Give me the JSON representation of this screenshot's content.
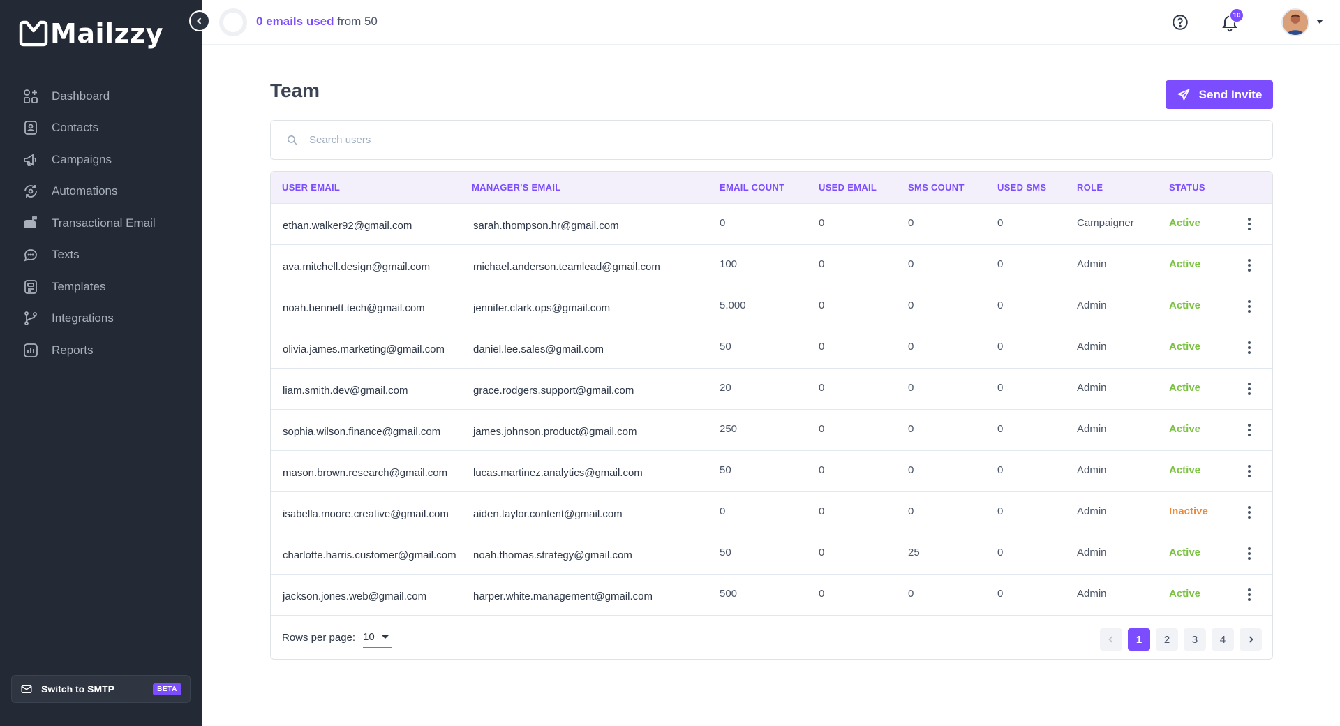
{
  "app": {
    "name": "Mailzzy"
  },
  "sidebar": {
    "items": [
      {
        "label": "Dashboard",
        "icon": "dashboard-icon"
      },
      {
        "label": "Contacts",
        "icon": "contacts-icon"
      },
      {
        "label": "Campaigns",
        "icon": "megaphone-icon"
      },
      {
        "label": "Automations",
        "icon": "automation-icon"
      },
      {
        "label": "Transactional Email",
        "icon": "mailbox-icon"
      },
      {
        "label": "Texts",
        "icon": "chat-icon"
      },
      {
        "label": "Templates",
        "icon": "template-icon"
      },
      {
        "label": "Integrations",
        "icon": "branch-icon"
      },
      {
        "label": "Reports",
        "icon": "chart-icon"
      }
    ],
    "smtp": {
      "label": "Switch to SMTP",
      "badge": "BETA"
    }
  },
  "header": {
    "usage": {
      "used": "0 emails used",
      "rest": "from 50"
    },
    "notifications": "10"
  },
  "page": {
    "title": "Team",
    "invite_label": "Send Invite",
    "search_placeholder": "Search users"
  },
  "table": {
    "columns": [
      "USER EMAIL",
      "MANAGER'S EMAIL",
      "EMAIL COUNT",
      "USED EMAIL",
      "SMS COUNT",
      "USED SMS",
      "ROLE",
      "STATUS"
    ],
    "rows": [
      {
        "user": "ethan.walker92@gmail.com",
        "manager": "sarah.thompson.hr@gmail.com",
        "email_count": "0",
        "used_email": "0",
        "sms_count": "0",
        "used_sms": "0",
        "role": "Campaigner",
        "status": "Active"
      },
      {
        "user": "ava.mitchell.design@gmail.com",
        "manager": "michael.anderson.teamlead@gmail.com",
        "email_count": "100",
        "used_email": "0",
        "sms_count": "0",
        "used_sms": "0",
        "role": "Admin",
        "status": "Active"
      },
      {
        "user": "noah.bennett.tech@gmail.com",
        "manager": "jennifer.clark.ops@gmail.com",
        "email_count": "5,000",
        "used_email": "0",
        "sms_count": "0",
        "used_sms": "0",
        "role": "Admin",
        "status": "Active"
      },
      {
        "user": "olivia.james.marketing@gmail.com",
        "manager": "daniel.lee.sales@gmail.com",
        "email_count": "50",
        "used_email": "0",
        "sms_count": "0",
        "used_sms": "0",
        "role": "Admin",
        "status": "Active"
      },
      {
        "user": "liam.smith.dev@gmail.com",
        "manager": "grace.rodgers.support@gmail.com",
        "email_count": "20",
        "used_email": "0",
        "sms_count": "0",
        "used_sms": "0",
        "role": "Admin",
        "status": "Active"
      },
      {
        "user": "sophia.wilson.finance@gmail.com",
        "manager": "james.johnson.product@gmail.com",
        "email_count": "250",
        "used_email": "0",
        "sms_count": "0",
        "used_sms": "0",
        "role": "Admin",
        "status": "Active"
      },
      {
        "user": "mason.brown.research@gmail.com",
        "manager": "lucas.martinez.analytics@gmail.com",
        "email_count": "50",
        "used_email": "0",
        "sms_count": "0",
        "used_sms": "0",
        "role": "Admin",
        "status": "Active"
      },
      {
        "user": "isabella.moore.creative@gmail.com",
        "manager": "aiden.taylor.content@gmail.com",
        "email_count": "0",
        "used_email": "0",
        "sms_count": "0",
        "used_sms": "0",
        "role": "Admin",
        "status": "Inactive"
      },
      {
        "user": "charlotte.harris.customer@gmail.com",
        "manager": "noah.thomas.strategy@gmail.com",
        "email_count": "50",
        "used_email": "0",
        "sms_count": "25",
        "used_sms": "0",
        "role": "Admin",
        "status": "Active"
      },
      {
        "user": "jackson.jones.web@gmail.com",
        "manager": "harper.white.management@gmail.com",
        "email_count": "500",
        "used_email": "0",
        "sms_count": "0",
        "used_sms": "0",
        "role": "Admin",
        "status": "Active"
      }
    ]
  },
  "pagination": {
    "rows_per_page_label": "Rows per page:",
    "rows_per_page": "10",
    "pages": [
      "1",
      "2",
      "3",
      "4"
    ],
    "current": "1"
  },
  "colors": {
    "accent": "#7c4dff",
    "sidebar": "#242a35",
    "active": "#7cc242",
    "inactive": "#ed8936"
  }
}
